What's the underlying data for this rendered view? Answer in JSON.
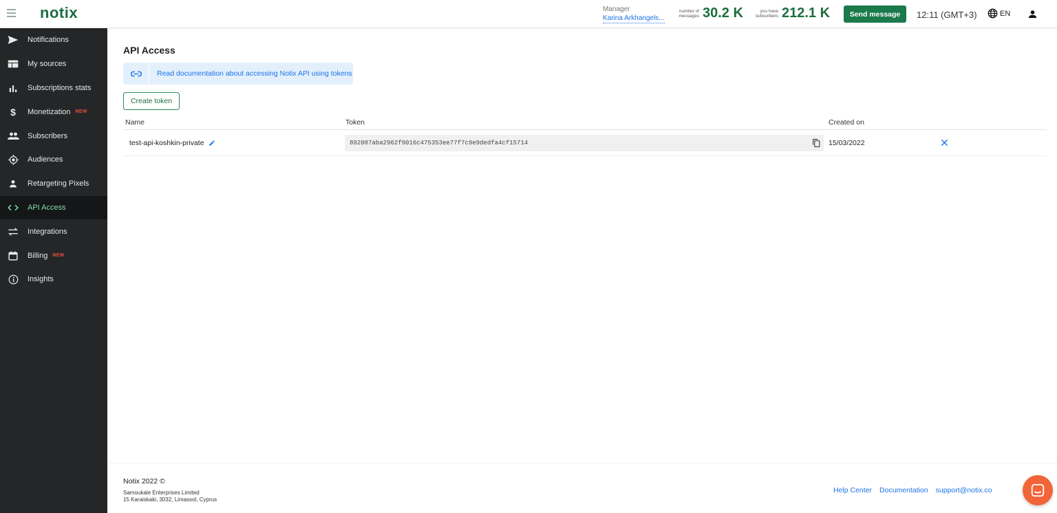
{
  "header": {
    "logo": "notix",
    "manager_label": "Manager",
    "manager_name": "Karina Arkhangels...",
    "messages_caption": "number of messages",
    "messages_value": "30.2 K",
    "subscribers_caption": "you have subscribers",
    "subscribers_value": "212.1 K",
    "send_button": "Send message",
    "time": "12:11 (GMT+3)",
    "language": "EN"
  },
  "sidebar": {
    "items": [
      {
        "label": "Notifications",
        "icon": "send-icon",
        "badge": ""
      },
      {
        "label": "My sources",
        "icon": "sources-icon",
        "badge": ""
      },
      {
        "label": "Subscriptions stats",
        "icon": "stats-icon",
        "badge": ""
      },
      {
        "label": "Monetization",
        "icon": "dollar-icon",
        "badge": "NEW"
      },
      {
        "label": "Subscribers",
        "icon": "people-icon",
        "badge": ""
      },
      {
        "label": "Audiences",
        "icon": "target-icon",
        "badge": ""
      },
      {
        "label": "Retargeting Pixels",
        "icon": "person-icon",
        "badge": ""
      },
      {
        "label": "API Access",
        "icon": "code-icon",
        "badge": "",
        "active": true
      },
      {
        "label": "Integrations",
        "icon": "swap-icon",
        "badge": ""
      },
      {
        "label": "Billing",
        "icon": "calendar-icon",
        "badge": "NEW"
      },
      {
        "label": "Insights",
        "icon": "info-icon",
        "badge": ""
      }
    ]
  },
  "main": {
    "title": "API Access",
    "doc_link": "Read documentation about accessing Notix API using tokens",
    "create_button": "Create token",
    "columns": {
      "name": "Name",
      "token": "Token",
      "created": "Created on"
    },
    "rows": [
      {
        "name": "test-api-koshkin-private",
        "token": "892087aba2962f9016c475353ee77f7c9e9dedfa4cf15714",
        "created": "15/03/2022"
      }
    ]
  },
  "footer": {
    "copyright": "Notix 2022 ©",
    "company": "Samoukale Enterprises Limited",
    "address": "15 Karaiskaki, 3032, Limassol, Cyprus",
    "links": [
      "Help Center",
      "Documentation",
      "support@notix.co"
    ]
  },
  "colors": {
    "brand": "#1b6d3f",
    "sidebar": "#242628",
    "active": "#7ee0a6",
    "link": "#1a73e8",
    "new_badge": "#e5533a",
    "chat": "#f26539"
  }
}
